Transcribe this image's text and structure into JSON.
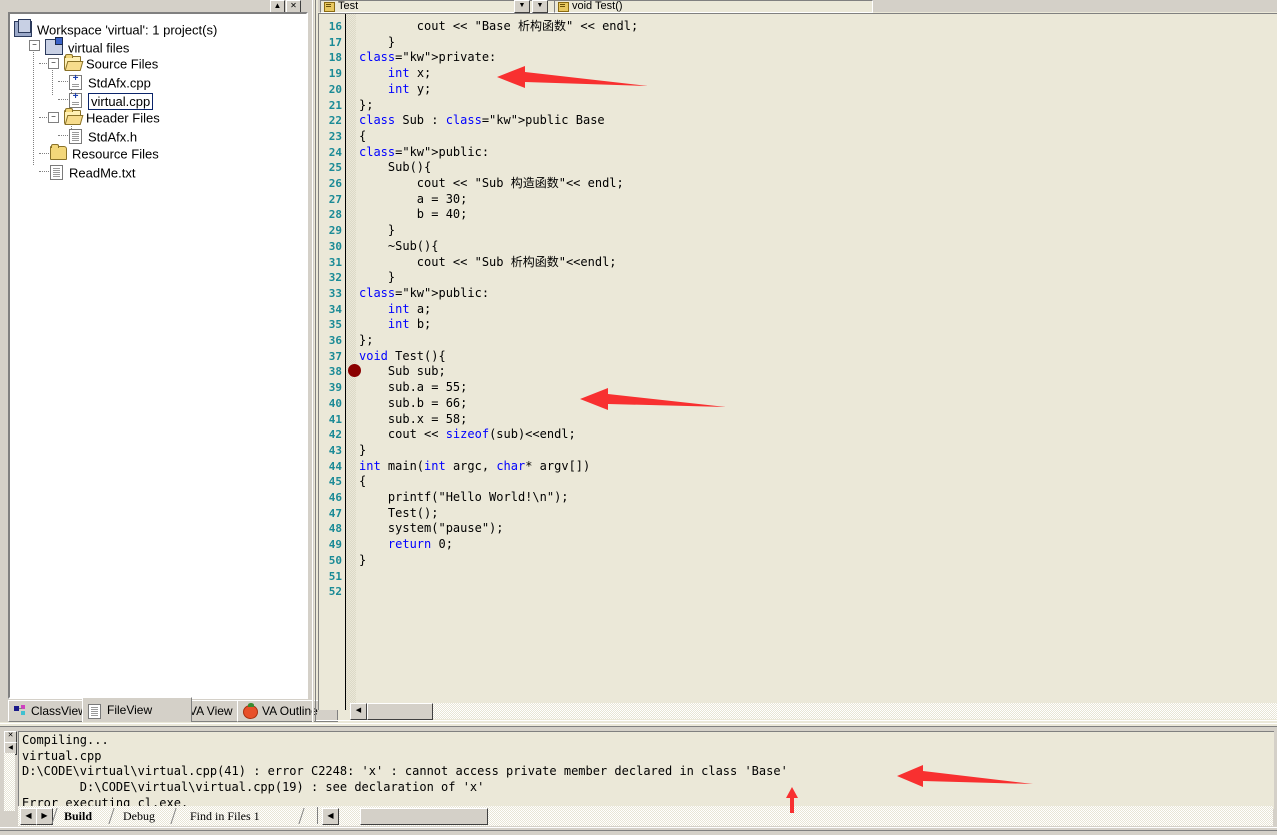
{
  "app": {
    "name": "Microsoft Visual C++ 6.0",
    "theme_accent": "#0a246a",
    "code_bg": "#ebe8d8",
    "keyword_color": "#0000ff",
    "lineno_color": "#1a8a96",
    "annotation_color": "#f83030"
  },
  "workspace": {
    "title_buttons": [
      "minimize-button",
      "close-button"
    ],
    "tree": [
      {
        "label": "Workspace 'virtual': 1 project(s)",
        "icon": "workspace-icon",
        "indent": 0,
        "expander": "",
        "selected": false
      },
      {
        "label": "virtual files",
        "icon": "project-icon",
        "indent": 1,
        "expander": "-",
        "selected": false
      },
      {
        "label": "Source Files",
        "icon": "folder-open-icon",
        "indent": 2,
        "expander": "-",
        "selected": false
      },
      {
        "label": "StdAfx.cpp",
        "icon": "cpp-file-icon",
        "indent": 3,
        "expander": "",
        "selected": false
      },
      {
        "label": "virtual.cpp",
        "icon": "cpp-file-icon",
        "indent": 3,
        "expander": "",
        "selected": true
      },
      {
        "label": "Header Files",
        "icon": "folder-open-icon",
        "indent": 2,
        "expander": "-",
        "selected": false
      },
      {
        "label": "StdAfx.h",
        "icon": "header-file-icon",
        "indent": 3,
        "expander": "",
        "selected": false
      },
      {
        "label": "Resource Files",
        "icon": "folder-icon",
        "indent": 2,
        "expander": "",
        "selected": false
      },
      {
        "label": "ReadMe.txt",
        "icon": "text-file-icon",
        "indent": 2,
        "expander": "",
        "selected": false
      }
    ],
    "tabs": [
      {
        "label": "ClassView",
        "icon": "classview-icon",
        "active": false
      },
      {
        "label": "FileView",
        "icon": "fileview-icon",
        "active": true
      },
      {
        "label": "VA View",
        "icon": "va-tomato-icon",
        "active": false
      },
      {
        "label": "VA Outline",
        "icon": "va-outline-icon",
        "active": false
      }
    ]
  },
  "editor": {
    "class_combo_value": "Test",
    "member_combo_value": "void Test()",
    "first_visible_line": 16,
    "breakpoint_line": 38,
    "lines": [
      {
        "n": 16,
        "text": "        cout << \"Base 析构函数\" << endl;"
      },
      {
        "n": 17,
        "text": "    }"
      },
      {
        "n": 18,
        "text": "private:"
      },
      {
        "n": 19,
        "text": "    int x;"
      },
      {
        "n": 20,
        "text": "    int y;"
      },
      {
        "n": 21,
        "text": "};"
      },
      {
        "n": 22,
        "text": "class Sub : public Base"
      },
      {
        "n": 23,
        "text": "{"
      },
      {
        "n": 24,
        "text": "public:"
      },
      {
        "n": 25,
        "text": "    Sub(){"
      },
      {
        "n": 26,
        "text": "        cout << \"Sub 构造函数\"<< endl;"
      },
      {
        "n": 27,
        "text": "        a = 30;"
      },
      {
        "n": 28,
        "text": "        b = 40;"
      },
      {
        "n": 29,
        "text": "    }"
      },
      {
        "n": 30,
        "text": "    ~Sub(){"
      },
      {
        "n": 31,
        "text": "        cout << \"Sub 析构函数\"<<endl;"
      },
      {
        "n": 32,
        "text": "    }"
      },
      {
        "n": 33,
        "text": "public:"
      },
      {
        "n": 34,
        "text": "    int a;"
      },
      {
        "n": 35,
        "text": "    int b;"
      },
      {
        "n": 36,
        "text": "};"
      },
      {
        "n": 37,
        "text": "void Test(){"
      },
      {
        "n": 38,
        "text": "    Sub sub;"
      },
      {
        "n": 39,
        "text": "    sub.a = 55;"
      },
      {
        "n": 40,
        "text": "    sub.b = 66;"
      },
      {
        "n": 41,
        "text": "    sub.x = 58;"
      },
      {
        "n": 42,
        "text": "    cout << sizeof(sub)<<endl;"
      },
      {
        "n": 43,
        "text": "}"
      },
      {
        "n": 44,
        "text": "int main(int argc, char* argv[])"
      },
      {
        "n": 45,
        "text": "{"
      },
      {
        "n": 46,
        "text": "    printf(\"Hello World!\\n\");"
      },
      {
        "n": 47,
        "text": "    Test();"
      },
      {
        "n": 48,
        "text": "    system(\"pause\");"
      },
      {
        "n": 49,
        "text": "    return 0;"
      },
      {
        "n": 50,
        "text": "}"
      },
      {
        "n": 51,
        "text": ""
      },
      {
        "n": 52,
        "text": ""
      }
    ]
  },
  "output": {
    "lines": [
      "Compiling...",
      "virtual.cpp",
      "D:\\CODE\\virtual\\virtual.cpp(41) : error C2248: 'x' : cannot access private member declared in class 'Base'",
      "        D:\\CODE\\virtual\\virtual.cpp(19) : see declaration of 'x'",
      "Error executing cl.exe."
    ],
    "tabs": [
      {
        "label": "Build",
        "active": true
      },
      {
        "label": "Debug",
        "active": false
      },
      {
        "label": "Find in Files 1",
        "active": false
      }
    ]
  },
  "annotations": [
    {
      "name": "arrow-int-x",
      "target": "line 19 int x;"
    },
    {
      "name": "arrow-sub-x-assign",
      "target": "line 41 sub.x = 58;"
    },
    {
      "name": "arrow-error-message",
      "target": "cannot access private member declared in class 'Base'"
    },
    {
      "name": "arrow-up-declaration",
      "target": "see declaration of 'x'"
    }
  ]
}
